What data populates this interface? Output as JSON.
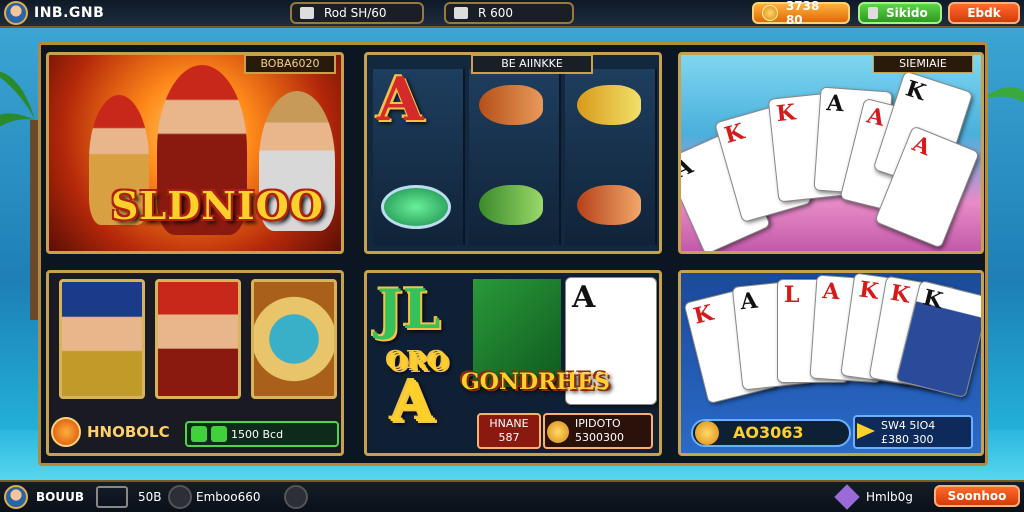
{
  "topbar": {
    "brand": "INB.GNB",
    "stat1": "Rod SH/60",
    "stat2": "R 600",
    "coins": "3738 80",
    "green_btn": "Sikido",
    "red_btn": "Ebdk"
  },
  "panels": {
    "hero": {
      "tag": "BOBA6020",
      "title": "SLDNIOO"
    },
    "reels": {
      "tag": "BE AIINKKE"
    },
    "cards_top": {
      "tag": "SIEMIAIE"
    },
    "characters": {
      "label": "HNOBOLC",
      "bar_text": "1500 Bcd"
    },
    "jackpot": {
      "title": "GONDRHES",
      "btn1_line1": "HNANE",
      "btn1_line2": "587",
      "btn2_line1": "IPIDOTO",
      "btn2_line2": "5300300"
    },
    "bonus": {
      "amount": "AO3063",
      "bar2_line1": "SW4 5IO4",
      "bar2_line2": "£380 300"
    }
  },
  "bottombar": {
    "label1": "BOUUB",
    "label2": "50B",
    "label3": "Emboo660",
    "label4": "Hmlb0g",
    "right_btn": "Soonhoo"
  },
  "colors": {
    "gold": "#c9a14a",
    "accent_orange": "#e06a0a",
    "accent_green": "#2b9a1e",
    "title_yellow": "#ffcf2a"
  }
}
